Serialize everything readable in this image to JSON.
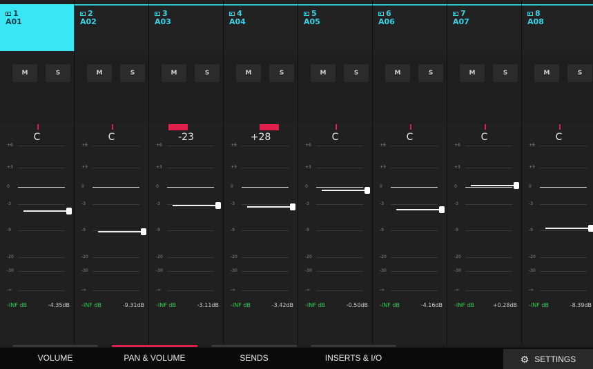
{
  "tracks": [
    {
      "num": "1",
      "name": "A01",
      "selected": true,
      "mute": "M",
      "solo": "S",
      "pan": "C",
      "pan_value": 0,
      "level_db": -4.35,
      "peak": "-INF dB",
      "volume": "-4.35dB"
    },
    {
      "num": "2",
      "name": "A02",
      "selected": false,
      "mute": "M",
      "solo": "S",
      "pan": "C",
      "pan_value": 0,
      "level_db": -9.31,
      "peak": "-INF dB",
      "volume": "-9.31dB"
    },
    {
      "num": "3",
      "name": "A03",
      "selected": false,
      "mute": "M",
      "solo": "S",
      "pan": "-23",
      "pan_value": -23,
      "level_db": -3.11,
      "peak": "-INF dB",
      "volume": "-3.11dB"
    },
    {
      "num": "4",
      "name": "A04",
      "selected": false,
      "mute": "M",
      "solo": "S",
      "pan": "+28",
      "pan_value": 28,
      "level_db": -3.42,
      "peak": "-INF dB",
      "volume": "-3.42dB"
    },
    {
      "num": "5",
      "name": "A05",
      "selected": false,
      "mute": "M",
      "solo": "S",
      "pan": "C",
      "pan_value": 0,
      "level_db": -0.5,
      "peak": "-INF dB",
      "volume": "-0.50dB"
    },
    {
      "num": "6",
      "name": "A06",
      "selected": false,
      "mute": "M",
      "solo": "S",
      "pan": "C",
      "pan_value": 0,
      "level_db": -4.16,
      "peak": "-INF dB",
      "volume": "-4.16dB"
    },
    {
      "num": "7",
      "name": "A07",
      "selected": false,
      "mute": "M",
      "solo": "S",
      "pan": "C",
      "pan_value": 0,
      "level_db": 0.28,
      "peak": "-INF dB",
      "volume": "+0.28dB"
    },
    {
      "num": "8",
      "name": "A08",
      "selected": false,
      "mute": "M",
      "solo": "S",
      "pan": "C",
      "pan_value": 0,
      "level_db": -8.39,
      "peak": "-INF dB",
      "volume": "-8.39dB"
    }
  ],
  "scale_labels": [
    "+6",
    "+3",
    "0",
    "-3",
    "-9",
    "-20",
    "-30",
    "-∞"
  ],
  "tabs": [
    {
      "label": "VOLUME",
      "active": false
    },
    {
      "label": "PAN & VOLUME",
      "active": true
    },
    {
      "label": "SENDS",
      "active": false
    },
    {
      "label": "INSERTS & I/O",
      "active": false
    }
  ],
  "settings": {
    "label": "SETTINGS",
    "icon": "gear-icon"
  },
  "colors": {
    "accent_cyan": "#38e6f4",
    "accent_red": "#e0204a",
    "peak_green": "#3fbf5a"
  }
}
